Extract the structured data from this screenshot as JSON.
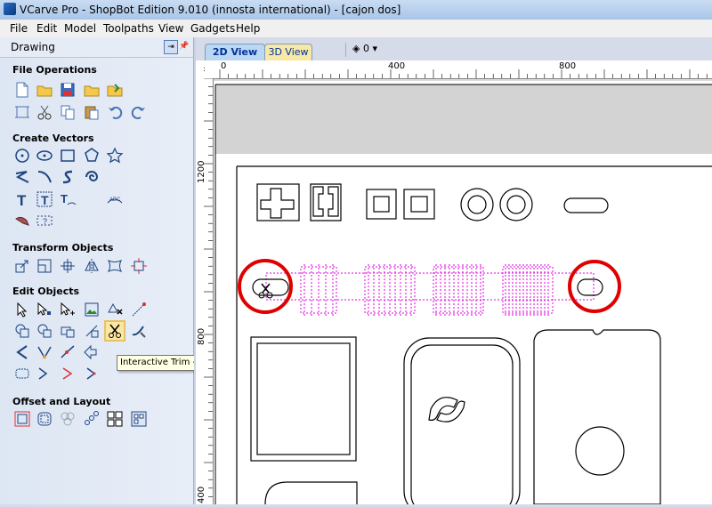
{
  "window": {
    "title": "VCarve Pro - ShopBot Edition 9.010 (innosta international) - [cajon dos]"
  },
  "menu": [
    "File",
    "Edit",
    "Model",
    "Toolpaths",
    "View",
    "Gadgets",
    "Help"
  ],
  "panel": {
    "title": "Drawing",
    "sections": {
      "file_operations": "File Operations",
      "create_vectors": "Create Vectors",
      "transform_objects": "Transform Objects",
      "edit_objects": "Edit Objects",
      "offset_layout": "Offset and Layout"
    },
    "tooltip": "Interactive Trim - trim vectors interactively"
  },
  "tabs": {
    "view2d": "2D View",
    "view3d": "3D View"
  },
  "layer_value": "0",
  "ruler": {
    "h": [
      "0",
      "400",
      "800"
    ],
    "v": [
      "1200",
      "800",
      "400"
    ]
  },
  "colors": {
    "accent_tab": "#bcd7f4",
    "highlight_circle": "#e00000",
    "selection_magenta": "#e000e0"
  }
}
